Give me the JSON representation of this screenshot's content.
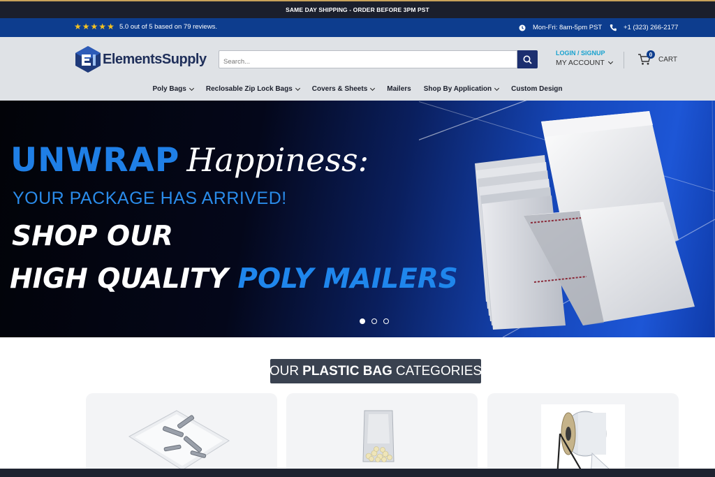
{
  "announcement": "SAME DAY SHIPPING - ORDER BEFORE 3PM PST",
  "rating": {
    "stars": 5,
    "text": "5.0 out of 5 based on 79 reviews."
  },
  "contact": {
    "hours": "Mon-Fri: 8am-5pm PST",
    "phone": "+1 (323) 266-2177"
  },
  "brand": {
    "name": "ElementsSupply"
  },
  "search": {
    "placeholder": "Search..."
  },
  "account": {
    "login": "LOGIN / SIGNUP",
    "label": "MY ACCOUNT"
  },
  "cart": {
    "label": "CART",
    "count": "0"
  },
  "nav": [
    {
      "label": "Poly Bags",
      "dropdown": true
    },
    {
      "label": "Reclosable Zip Lock Bags",
      "dropdown": true
    },
    {
      "label": "Covers & Sheets",
      "dropdown": true
    },
    {
      "label": "Mailers",
      "dropdown": false
    },
    {
      "label": "Shop By Application",
      "dropdown": true
    },
    {
      "label": "Custom Design",
      "dropdown": false
    }
  ],
  "hero": {
    "line1a": "UNWRAP",
    "line1b": "Happiness:",
    "line2": "YOUR PACKAGE HAS ARRIVED!",
    "line3": "SHOP OUR",
    "line4a": "HIGH QUALITY",
    "line4b": "POLY MAILERS",
    "slides": 3,
    "active_slide": 1
  },
  "categories": {
    "title_pre": "OUR",
    "title_bold": "PLASTIC BAG",
    "title_post": "CATEGORIES"
  },
  "colors": {
    "navy": "#0d3d8e",
    "dark": "#1b1f2c",
    "accent": "#18a2cf",
    "star": "#f6c320"
  }
}
